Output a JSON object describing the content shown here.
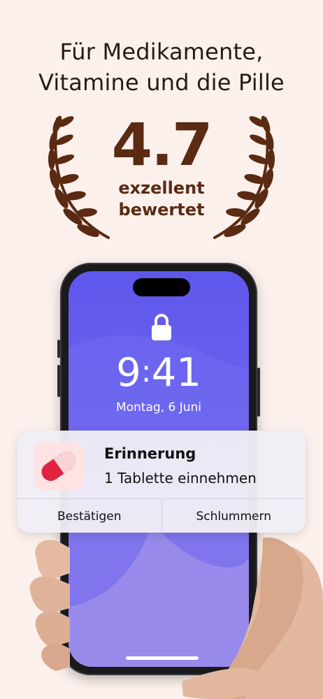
{
  "headline": {
    "line1": "Für Medikamente,",
    "line2": "Vitamine und die Pille"
  },
  "rating": {
    "value": "4.7",
    "label_line1": "exzellent",
    "label_line2": "bewertet"
  },
  "lockscreen": {
    "time_hours": "9",
    "time_minutes": "41",
    "date": "Montag, 6 Juni"
  },
  "notification": {
    "title": "Erinnerung",
    "body": "1 Tablette einnehmen",
    "actions": [
      {
        "label": "Bestätigen"
      },
      {
        "label": "Schlummern"
      }
    ]
  },
  "colors": {
    "background": "#FBF0EC",
    "laurel": "#5A2A12",
    "screen": "#5E57EC",
    "pill_red": "#E0243F"
  }
}
